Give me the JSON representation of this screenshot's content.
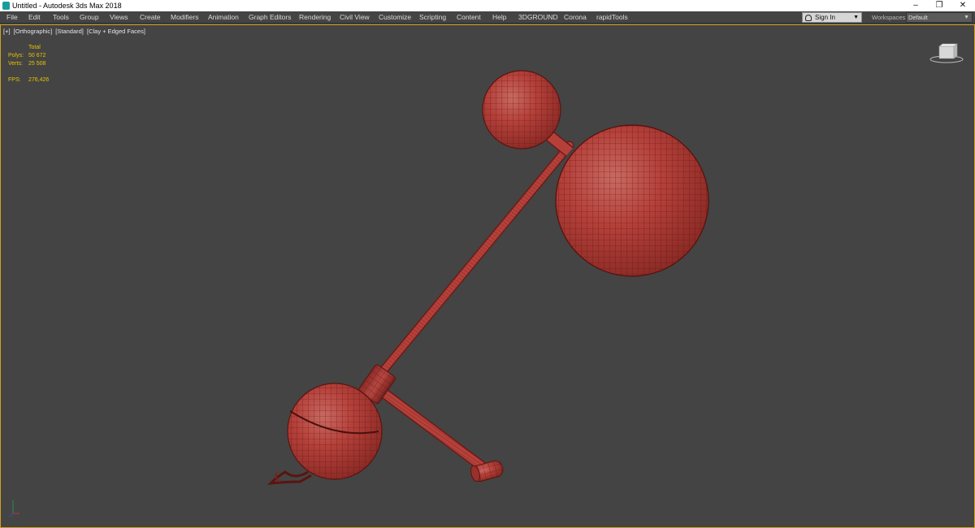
{
  "window": {
    "title": "Untitled - Autodesk 3ds Max 2018",
    "minimize": "–",
    "restore": "❐",
    "close": "✕"
  },
  "menu": [
    "File",
    "Edit",
    "Tools",
    "Group",
    "Views",
    "Create",
    "Modifiers",
    "Animation",
    "Graph Editors",
    "Rendering",
    "Civil View",
    "Customize",
    "Scripting",
    "Content",
    "Help",
    "3DGROUND",
    "Corona",
    "rapidTools"
  ],
  "signin": {
    "label": "Sign In"
  },
  "workspaces": {
    "label": "Workspaces:",
    "value": "Default"
  },
  "viewport": {
    "labels": [
      "[+]",
      "[Orthographic]",
      "[Standard]",
      "[Clay + Edged Faces]"
    ],
    "stats": {
      "header": "Total",
      "polys_label": "Polys:",
      "polys_value": "50 672",
      "verts_label": "Verts:",
      "verts_value": "25 508",
      "fps_label": "FPS:",
      "fps_value": "276,426"
    }
  },
  "colors": {
    "viewport_bg": "#444444",
    "active_border": "#d2a020",
    "stats_text": "#e6c300",
    "clay": "#b5403a"
  },
  "icons": {
    "app": "3ds-max-icon",
    "viewcube": "viewcube-icon",
    "axis": "axis-tripod-icon"
  }
}
